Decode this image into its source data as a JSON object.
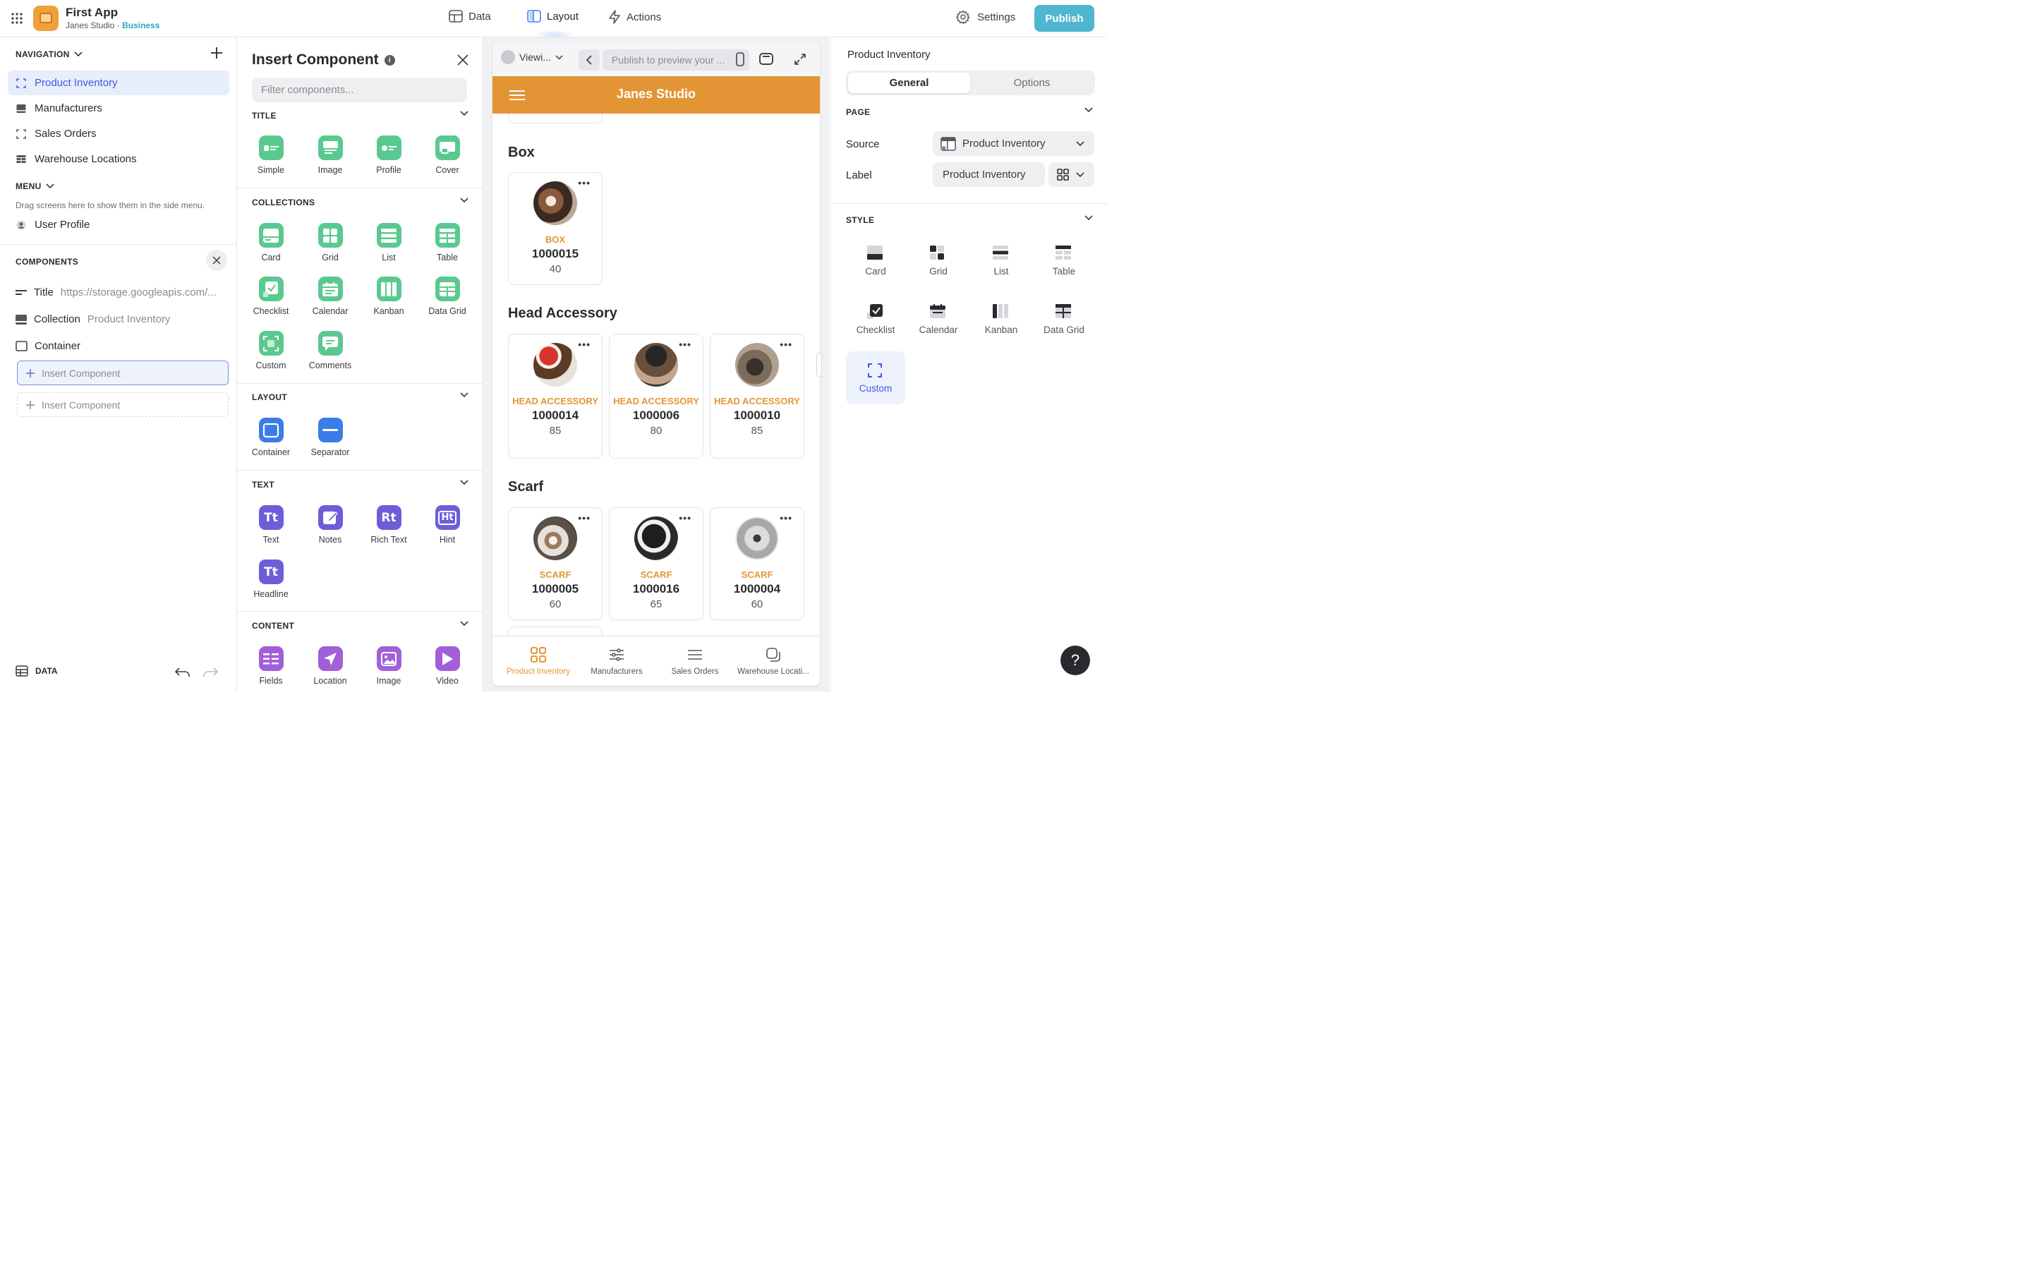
{
  "topbar": {
    "app_title": "First App",
    "workspace": "Janes Studio",
    "separator": "·",
    "plan": "Business",
    "nav": [
      {
        "label": "Data",
        "icon": "table-icon"
      },
      {
        "label": "Layout",
        "icon": "layout-icon",
        "active": true
      },
      {
        "label": "Actions",
        "icon": "lightning-icon"
      }
    ],
    "settings_label": "Settings",
    "publish_label": "Publish",
    "accent_color": "#4fb6cf"
  },
  "left": {
    "navigation_header": "NAVIGATION",
    "nav_items": [
      {
        "label": "Product Inventory",
        "active": true
      },
      {
        "label": "Manufacturers"
      },
      {
        "label": "Sales Orders"
      },
      {
        "label": "Warehouse Locations"
      }
    ],
    "menu_header": "MENU",
    "menu_hint": "Drag screens here to show them in the side menu.",
    "menu_item": "User Profile",
    "components_header": "COMPONENTS",
    "components": [
      {
        "label": "Title",
        "sub": "https://storage.googleapis.com/..."
      },
      {
        "label": "Collection",
        "sub": "Product Inventory"
      },
      {
        "label": "Container",
        "sub": ""
      }
    ],
    "insert_label_1": "Insert Component",
    "insert_label_2": "Insert Component",
    "data_label": "DATA"
  },
  "insert_panel": {
    "title": "Insert Component",
    "info": "i",
    "filter_placeholder": "Filter components...",
    "categories": [
      {
        "name": "TITLE",
        "items": [
          "Simple",
          "Image",
          "Profile",
          "Cover"
        ]
      },
      {
        "name": "COLLECTIONS",
        "items": [
          "Card",
          "Grid",
          "List",
          "Table",
          "Checklist",
          "Calendar",
          "Kanban",
          "Data Grid",
          "Custom",
          "Comments"
        ]
      },
      {
        "name": "LAYOUT",
        "items": [
          "Container",
          "Separator"
        ]
      },
      {
        "name": "TEXT",
        "items": [
          "Text",
          "Notes",
          "Rich Text",
          "Hint",
          "Headline"
        ]
      },
      {
        "name": "CONTENT",
        "items": [
          "Fields",
          "Location",
          "Image",
          "Video"
        ]
      }
    ],
    "text_icon_glyphs": {
      "text": "Tt",
      "rich_text": "Rt",
      "hint": "Ht",
      "headline": "Tt"
    }
  },
  "preview": {
    "viewing_label": "Viewi...",
    "publish_preview": "Publish to preview your ...",
    "app_header": "Janes Studio",
    "header_color": "#e39535",
    "groups": [
      {
        "title": "Box",
        "cards": [
          {
            "category": "BOX",
            "code": "1000015",
            "qty": "40"
          }
        ]
      },
      {
        "title": "Head Accessory",
        "cards": [
          {
            "category": "HEAD ACCESSORY",
            "code": "1000014",
            "qty": "85"
          },
          {
            "category": "HEAD ACCESSORY",
            "code": "1000006",
            "qty": "80"
          },
          {
            "category": "HEAD ACCESSORY",
            "code": "1000010",
            "qty": "85"
          }
        ]
      },
      {
        "title": "Scarf",
        "cards": [
          {
            "category": "SCARF",
            "code": "1000005",
            "qty": "60"
          },
          {
            "category": "SCARF",
            "code": "1000016",
            "qty": "65"
          },
          {
            "category": "SCARF",
            "code": "1000004",
            "qty": "60"
          }
        ]
      }
    ],
    "card_menu": "•••",
    "tabs": [
      {
        "label": "Product Inventory",
        "active": true
      },
      {
        "label": "Manufacturers"
      },
      {
        "label": "Sales Orders"
      },
      {
        "label": "Warehouse Locati..."
      }
    ]
  },
  "right": {
    "title": "Product Inventory",
    "tabs": [
      "General",
      "Options"
    ],
    "page_header": "PAGE",
    "source_label": "Source",
    "source_value": "Product Inventory",
    "label_label": "Label",
    "label_value": "Product Inventory",
    "style_header": "STYLE",
    "styles": [
      "Card",
      "Grid",
      "List",
      "Table",
      "Checklist",
      "Calendar",
      "Kanban",
      "Data Grid",
      "Custom"
    ],
    "active_style": "Custom"
  },
  "help_label": "?"
}
